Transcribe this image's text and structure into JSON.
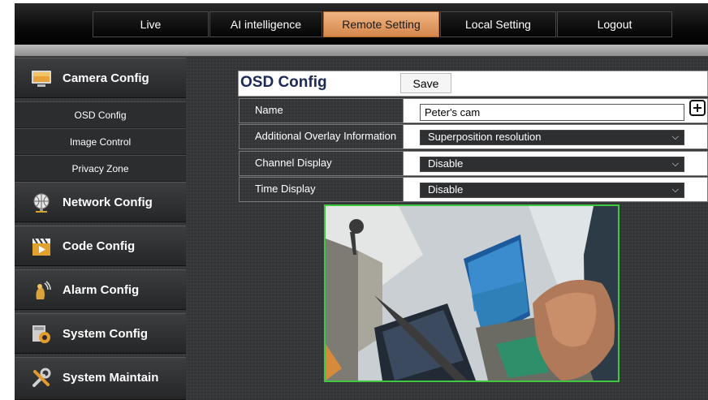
{
  "nav": {
    "tabs": [
      {
        "label": "Live"
      },
      {
        "label": "AI intelligence"
      },
      {
        "label": "Remote Setting"
      },
      {
        "label": "Local Setting"
      },
      {
        "label": "Logout"
      }
    ],
    "active_tab": "Remote Setting"
  },
  "sidebar": {
    "camera_config": "Camera Config",
    "osd_config": "OSD Config",
    "image_control": "Image Control",
    "privacy_zone": "Privacy Zone",
    "network_config": "Network Config",
    "code_config": "Code Config",
    "alarm_config": "Alarm Config",
    "system_config": "System Config",
    "system_maintain": "System Maintain"
  },
  "osd": {
    "title": "OSD Config",
    "save_label": "Save",
    "rows": {
      "name": {
        "label": "Name",
        "value": "Peter's cam"
      },
      "overlay": {
        "label": "Additional Overlay Information",
        "value": "Superposition resolution"
      },
      "channel": {
        "label": "Channel Display",
        "value": "Disable"
      },
      "time": {
        "label": "Time Display",
        "value": "Disable"
      }
    }
  },
  "colors": {
    "active_tab": "#d4864a",
    "preview_border": "#3fc83f",
    "title_text": "#1d2a55"
  },
  "icons": {
    "add": "plus-square-icon",
    "select": "chevron-down-icon"
  }
}
